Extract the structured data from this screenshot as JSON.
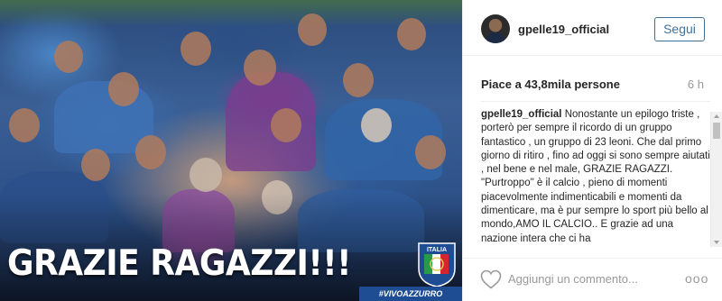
{
  "post": {
    "image": {
      "caption": "GRAZIE RAGAZZI!!!",
      "hashtag": "#VIVOAZZURRO",
      "crest_text": "ITALIA"
    }
  },
  "header": {
    "username": "gpelle19_official",
    "follow_label": "Segui"
  },
  "stats": {
    "likes": "Piace a 43,8mila persone",
    "time": "6 h"
  },
  "comments": [
    {
      "author": "gpelle19_official",
      "text": "Nonostante un epilogo triste , porterò per sempre il ricordo di un gruppo fantastico , un gruppo di 23 leoni. Che dal primo giorno di ritiro , fino ad oggi si sono sempre aiutati , nel bene e nel male, GRAZIE RAGAZZI. \"Purtroppo\" è il calcio , pieno di momenti piacevolmente indimenticabili e momenti da dimenticare, ma è pur sempre lo sport più bello al mondo,AMO IL CALCIO.. E grazie ad una nazione intera che ci ha"
    }
  ],
  "footer": {
    "comment_placeholder": "Aggiungi un commento...",
    "more_label": "ooo"
  },
  "icons": {
    "heart": "heart-icon",
    "more": "more-options-icon",
    "scroll_up": "scroll-up-arrow-icon",
    "scroll_down": "scroll-down-arrow-icon"
  },
  "colors": {
    "follow_blue": "#3f729b",
    "muted_gray": "#999999",
    "hashtag_bg": "#1f4d93"
  }
}
